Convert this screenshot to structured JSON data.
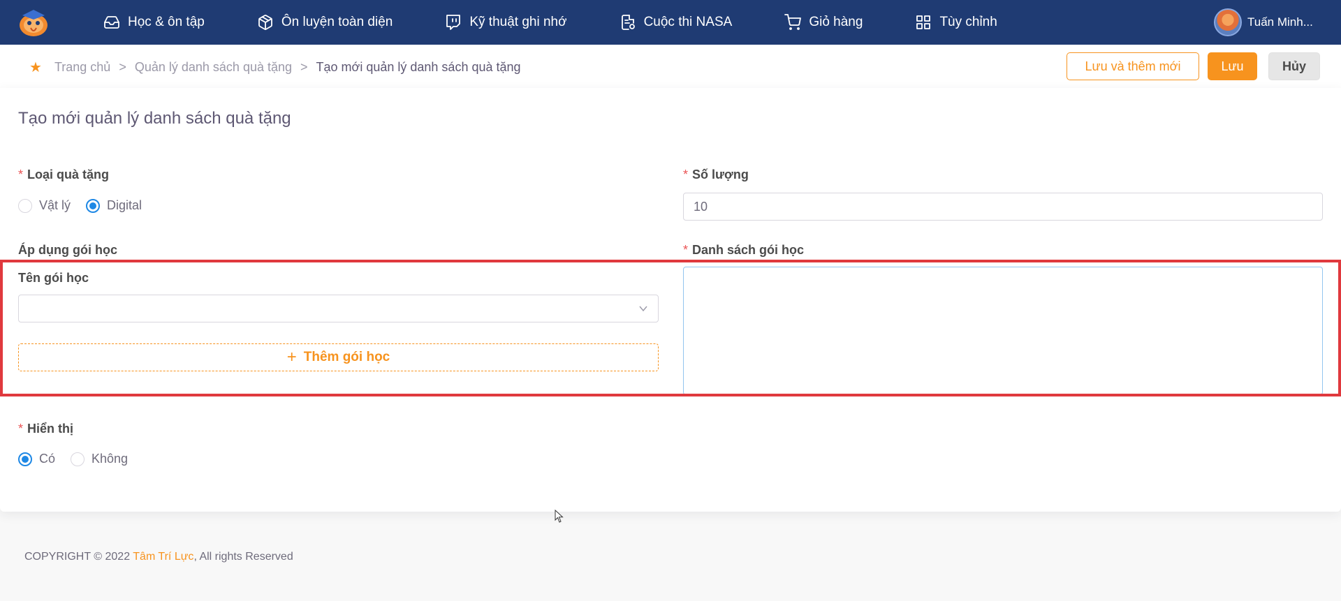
{
  "nav": {
    "items": [
      {
        "label": "Học & ôn tập",
        "icon": "inbox-icon"
      },
      {
        "label": "Ôn luyện toàn diện",
        "icon": "package-icon"
      },
      {
        "label": "Kỹ thuật ghi nhớ",
        "icon": "message-square-icon"
      },
      {
        "label": "Cuộc thi NASA",
        "icon": "document-badge-icon"
      },
      {
        "label": "Giỏ hàng",
        "icon": "shopping-cart-icon"
      },
      {
        "label": "Tùy chỉnh",
        "icon": "grid-icon"
      }
    ],
    "user_name": "Tuấn Minh..."
  },
  "breadcrumb": {
    "home": "Trang chủ",
    "sep": ">",
    "parent": "Quản lý danh sách quà tặng",
    "current": "Tạo mới quản lý danh sách quà tặng"
  },
  "actions": {
    "save_and_new": "Lưu và thêm mới",
    "save": "Lưu",
    "cancel": "Hủy"
  },
  "form": {
    "title": "Tạo mới quản lý danh sách quà tặng",
    "required_mark": "*",
    "gift_type": {
      "label": "Loại quà tặng",
      "options": [
        "Vật lý",
        "Digital"
      ],
      "selected": "Digital"
    },
    "quantity": {
      "label": "Số lượng",
      "value": "10"
    },
    "apply_package": {
      "label": "Áp dụng gói học",
      "name_label": "Tên gói học",
      "select_value": "",
      "add_button": "Thêm gói học"
    },
    "package_list": {
      "label": "Danh sách gói học"
    },
    "display": {
      "label": "Hiển thị",
      "options": [
        "Có",
        "Không"
      ],
      "selected": "Có"
    }
  },
  "footer": {
    "prefix": "COPYRIGHT © 2022 ",
    "brand": "Tâm Trí Lực",
    "suffix": ", All rights Reserved"
  },
  "colors": {
    "nav_bg": "#1f3b73",
    "accent": "#f7931e",
    "radio_selected": "#1e88e5",
    "required": "#ea5455",
    "highlight": "#e0393e"
  }
}
